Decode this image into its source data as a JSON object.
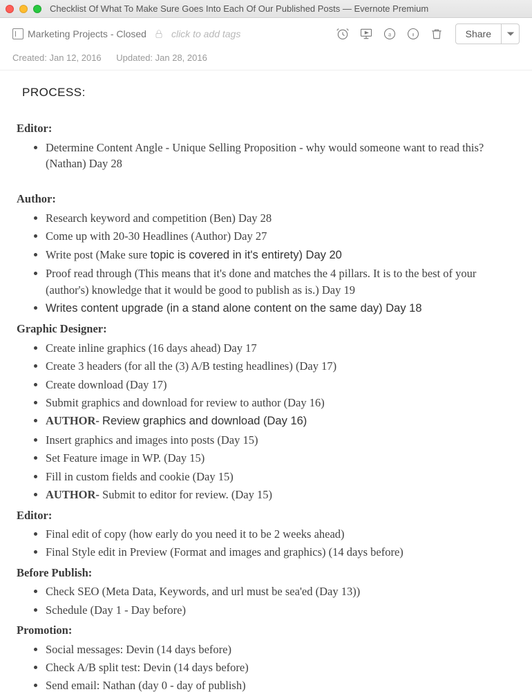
{
  "window": {
    "title": "Checklist Of What To Make Sure Goes Into Each Of Our Published Posts — Evernote Premium"
  },
  "toolbar": {
    "notebook": "Marketing Projects - Closed",
    "tags_placeholder": "click to add tags",
    "share_label": "Share"
  },
  "meta": {
    "created": "Created: Jan 12, 2016",
    "updated": "Updated: Jan 28, 2016"
  },
  "note": {
    "process_heading": "PROCESS:",
    "editor1_h": "Editor:",
    "editor1_items": [
      "Determine Content Angle - Unique Selling Proposition - why would someone want to read this? (Nathan) Day 28"
    ],
    "author_h": "Author:",
    "author_items": [
      "Research keyword and competition (Ben) Day 28",
      "Come up with 20-30 Headlines (Author) Day 27"
    ],
    "author_item3_a": "Write post (Make sure ",
    "author_item3_b": "topic is covered in it's entirety) Day 20",
    "author_item4": "Proof read through (This means that it's done and matches the 4 pillars. It is to the best of your (author's) knowledge that it would be good to publish as is.) Day 19",
    "author_item5": "Writes content upgrade (in a stand alone content on the same day) Day 18",
    "gd_h": "Graphic Designer:",
    "gd_items_a": [
      "Create inline graphics (16 days ahead) Day 17",
      "Create 3 headers (for all the (3) A/B testing headlines) (Day 17)",
      "Create download (Day 17)",
      "Submit graphics and download for review to author (Day 16)"
    ],
    "gd_item5_a": "AUTHOR- ",
    "gd_item5_b": "Review graphics and download (Day 16)",
    "gd_items_b": [
      "Insert graphics and images into posts (Day 15)",
      "Set Feature image in WP. (Day 15)",
      "Fill in custom fields and cookie (Day 15)"
    ],
    "gd_item9_a": "AUTHOR- ",
    "gd_item9_b": "Submit to editor for review. (Day 15)",
    "editor2_h": "Editor:",
    "editor2_items": [
      "Final edit of copy (how early do you need it to be 2 weeks ahead)",
      "Final Style edit in Preview (Format and images and graphics) (14 days before)"
    ],
    "before_h": "Before Publish:",
    "before_items": [
      "Check SEO (Meta Data, Keywords, and url must be sea'ed (Day 13))",
      "Schedule (Day 1 - Day before)"
    ],
    "promo_h": "Promotion:",
    "promo_items": [
      "Social messages: Devin (14 days before)",
      "Check A/B split test: Devin (14 days before)",
      "Send email: Nathan (day 0 - day of publish)"
    ]
  }
}
